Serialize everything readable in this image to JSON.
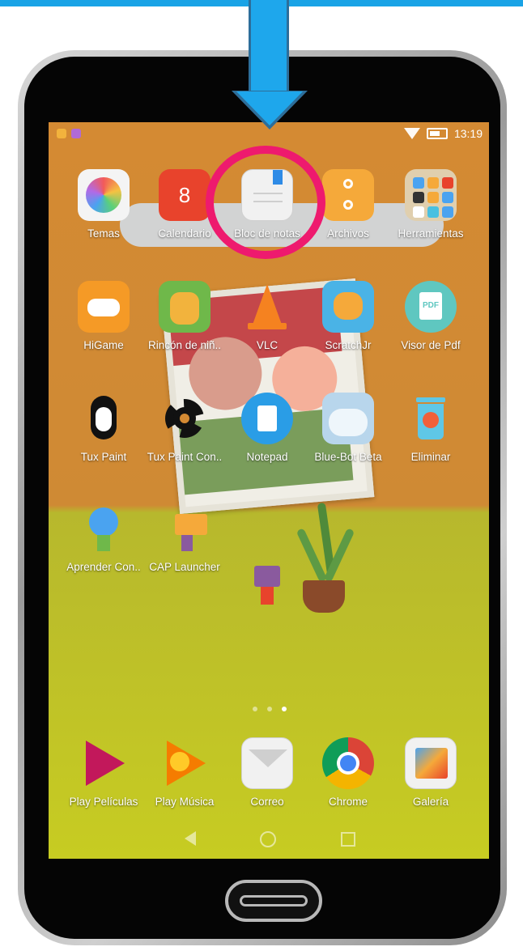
{
  "statusbar": {
    "time": "13:19"
  },
  "apps": [
    {
      "label": "Temas"
    },
    {
      "label": "Calendario",
      "badge": "8"
    },
    {
      "label": "Bloc de notas"
    },
    {
      "label": "Archivos"
    },
    {
      "label": "Herramientas"
    },
    {
      "label": "HiGame"
    },
    {
      "label": "Rincón de niñ.."
    },
    {
      "label": "VLC"
    },
    {
      "label": "ScratchJr"
    },
    {
      "label": "Visor de Pdf"
    },
    {
      "label": "Tux Paint"
    },
    {
      "label": "Tux Paint Con.."
    },
    {
      "label": "Notepad"
    },
    {
      "label": "Blue-Bot Beta"
    },
    {
      "label": "Eliminar"
    },
    {
      "label": "Aprender Con.."
    },
    {
      "label": "CAP Launcher"
    }
  ],
  "dock": [
    {
      "label": "Play Películas"
    },
    {
      "label": "Play Música"
    },
    {
      "label": "Correo"
    },
    {
      "label": "Chrome"
    },
    {
      "label": "Galería"
    }
  ],
  "icons": {
    "pdf": "PDF"
  },
  "colors": {
    "highlight": "#ee1a6e",
    "arrow": "#1ea7ec"
  }
}
